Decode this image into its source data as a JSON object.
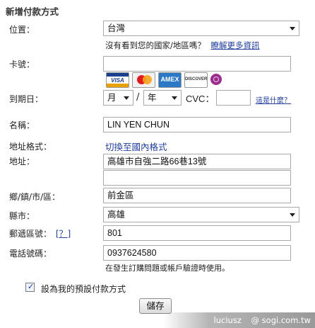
{
  "form": {
    "title": "新增付款方式",
    "location": {
      "label": "位置：",
      "value": "台灣",
      "hint": "沒有看到您的國家/地區嗎？",
      "hint_link": "瞭解更多資訊"
    },
    "card_number": {
      "label": "卡號：",
      "value": ""
    },
    "card_icons": {
      "visa": "VISA",
      "mastercard": "MasterCard",
      "amex": "AMEX",
      "discover": "DISCOVER",
      "jcb": "jcb-icon"
    },
    "expiry": {
      "label": "到期日：",
      "month": "月",
      "separator": "/",
      "year": "年",
      "cvc_label": "CVC：",
      "cvc_value": "",
      "cvc_help_link": "這是什麼？"
    },
    "name": {
      "label": "名稱：",
      "value": "LIN YEN CHUN"
    },
    "address_format": {
      "label": "地址格式：",
      "link": "切換至國內格式"
    },
    "address": {
      "label": "地址：",
      "line1": "高雄市自強二路66巷13號",
      "line2": ""
    },
    "district": {
      "label": "鄉/鎮/市/區：",
      "value": "前金區"
    },
    "city": {
      "label": "縣市：",
      "value": "高雄"
    },
    "postal_code": {
      "label": "郵遞區號：",
      "help": "[？]",
      "value": "801"
    },
    "phone": {
      "label": "電話號碼：",
      "value": "0937624580",
      "hint": "在發生訂購問題或帳戶驗證時使用。"
    },
    "default_checkbox": {
      "label": "設為我的預設付款方式",
      "checked": true
    },
    "save_label": "儲存"
  },
  "watermark": {
    "user": "luciusz",
    "site": "@ sogi.com.tw"
  },
  "colors": {
    "link": "#1f3e9c",
    "border": "#a9a9a9"
  }
}
